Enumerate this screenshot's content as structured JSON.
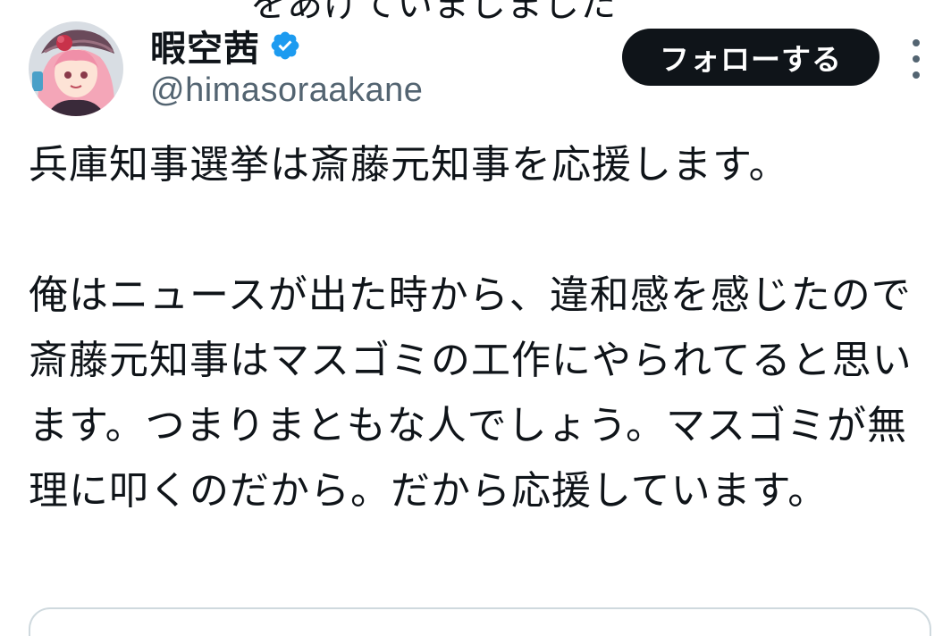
{
  "top_clipped_text": "をあげていましました",
  "account": {
    "display_name": "暇空茜",
    "handle": "@himasoraakane",
    "verified": true,
    "avatar_icon": "user-avatar-anime-girl"
  },
  "actions": {
    "follow_label": "フォローする",
    "more_icon": "more-vertical-icon"
  },
  "tweet": {
    "line1": "兵庫知事選挙は斎藤元知事を応援します。",
    "paragraph2": "俺はニュースが出た時から、違和感を感じたので斎藤元知事はマスゴミの工作にやられてると思います。つまりまともな人でしょう。マスゴミが無理に叩くのだから。だから応援しています。"
  },
  "colors": {
    "text": "#0f1419",
    "secondary_text": "#536471",
    "verified_blue": "#1d9bf0",
    "button_bg": "#0f1419",
    "border": "#cfd9de"
  }
}
